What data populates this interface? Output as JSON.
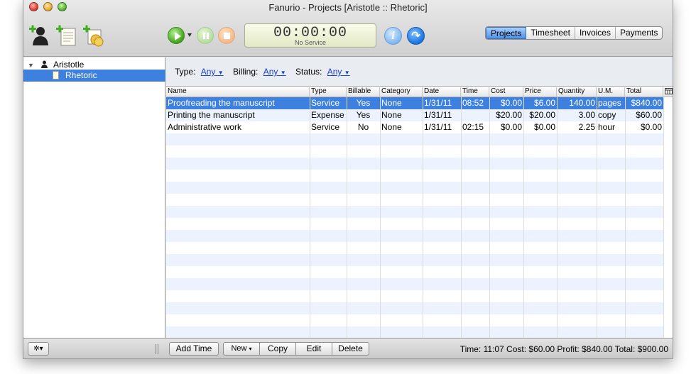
{
  "window": {
    "title": "Fanurio - Projects [Aristotle :: Rhetoric]"
  },
  "toolbar": {
    "icons": [
      "add-client-icon",
      "add-project-icon",
      "add-expense-icon"
    ],
    "timer": {
      "time": "00:00:00",
      "service": "No Service"
    },
    "tabs": [
      {
        "label": "Projects",
        "active": true
      },
      {
        "label": "Timesheet",
        "active": false
      },
      {
        "label": "Invoices",
        "active": false
      },
      {
        "label": "Payments",
        "active": false
      }
    ]
  },
  "sidebar": {
    "client": "Aristotle",
    "project": "Rhetoric"
  },
  "filters": {
    "type_label": "Type:",
    "type_value": "Any",
    "billing_label": "Billing:",
    "billing_value": "Any",
    "status_label": "Status:",
    "status_value": "Any"
  },
  "table": {
    "columns": [
      "Name",
      "Type",
      "Billable",
      "Category",
      "Date",
      "Time",
      "Cost",
      "Price",
      "Quantity",
      "U.M.",
      "Total"
    ],
    "rows": [
      [
        "Proofreading the manuscript",
        "Service",
        "Yes",
        "None",
        "1/31/11",
        "08:52",
        "$0.00",
        "$6.00",
        "140.00",
        "pages",
        "$840.00"
      ],
      [
        "Printing the manuscript",
        "Expense",
        "Yes",
        "None",
        "1/31/11",
        "",
        "$20.00",
        "$20.00",
        "3.00",
        "copy",
        "$60.00"
      ],
      [
        "Administrative work",
        "Service",
        "No",
        "None",
        "1/31/11",
        "02:15",
        "$0.00",
        "$0.00",
        "2.25",
        "hour",
        "$0.00"
      ]
    ]
  },
  "bottom": {
    "add_time": "Add Time",
    "new": "New",
    "copy": "Copy",
    "edit": "Edit",
    "delete": "Delete",
    "status": "Time: 11:07 Cost: $60.00 Profit: $840.00 Total: $900.00"
  },
  "colors": {
    "selection": "#3d80df",
    "stripe": "#edf3fe",
    "link": "#1a3ed8"
  }
}
